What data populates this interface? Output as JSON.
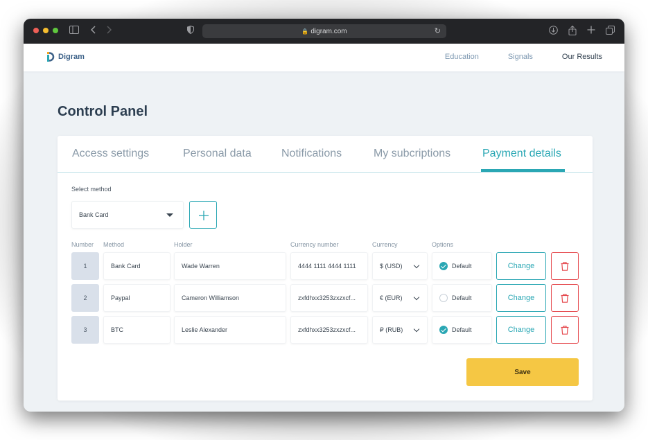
{
  "browser": {
    "url": "digram.com",
    "icons": [
      "sidebar-icon",
      "back-icon",
      "forward-icon",
      "shield-icon",
      "lock-icon",
      "reload-icon",
      "download-icon",
      "share-icon",
      "new-tab-icon",
      "tabs-icon"
    ]
  },
  "header": {
    "logo_text": "Digram",
    "nav": [
      "Education",
      "Signals",
      "Our Results"
    ]
  },
  "page": {
    "title": "Control Panel"
  },
  "tabs": [
    "Access settings",
    "Personal data",
    "Notifications",
    "My subcriptions",
    "Payment details"
  ],
  "active_tab": "Payment details",
  "form": {
    "select_label": "Select method",
    "selected_method": "Bank Card"
  },
  "table": {
    "columns": [
      "Number",
      "Method",
      "Holder",
      "Currency number",
      "Currency",
      "Options"
    ],
    "rows": [
      {
        "number": "1",
        "method": "Bank Card",
        "holder": "Wade Warren",
        "currency_number": "4444 1111 4444 1111",
        "currency": "$ (USD)",
        "option": "Default",
        "default": true,
        "change": "Change"
      },
      {
        "number": "2",
        "method": "Paypal",
        "holder": "Cameron Williamson",
        "currency_number": "zxfdhxx3253zxzxcf...",
        "currency": "€ (EUR)",
        "option": "Default",
        "default": false,
        "change": "Change"
      },
      {
        "number": "3",
        "method": "BTC",
        "holder": "Leslie Alexander",
        "currency_number": "zxfdhxx3253zxzxcf...",
        "currency": "₽ (RUB)",
        "option": "Default",
        "default": true,
        "change": "Change"
      }
    ]
  },
  "save_label": "Save",
  "colors": {
    "accent": "#2aa7b4",
    "danger": "#e5484d",
    "save": "#f5c744",
    "title": "#2c3e50"
  }
}
